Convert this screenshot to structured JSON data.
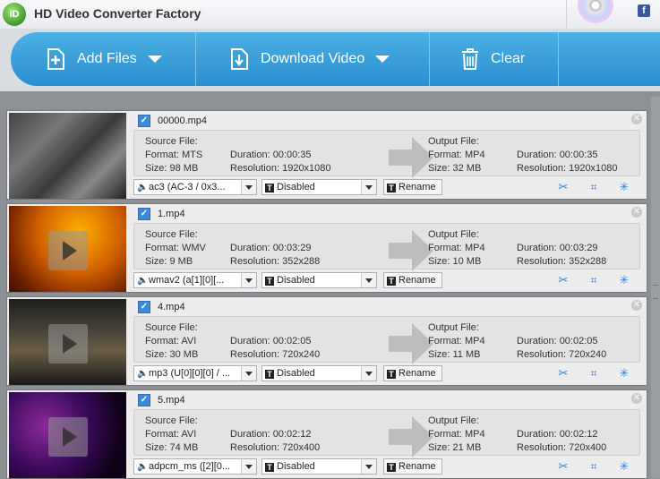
{
  "app": {
    "title": "HD Video Converter Factory",
    "logo_text": "iD",
    "social": "f"
  },
  "toolbar": {
    "add_files": "Add Files",
    "download_video": "Download Video",
    "clear": "Clear"
  },
  "labels": {
    "source_file": "Source File:",
    "output_file": "Output File:",
    "rename": "Rename"
  },
  "items": [
    {
      "filename": "00000.mp4",
      "src_format": "Format: MTS",
      "src_size": "Size: 98 MB",
      "src_duration": "Duration: 00:00:35",
      "src_resolution": "Resolution: 1920x1080",
      "out_format": "Format: MP4",
      "out_size": "Size: 32 MB",
      "out_duration": "Duration: 00:00:35",
      "out_resolution": "Resolution: 1920x1080",
      "audio": "ac3 (AC-3 / 0x3...",
      "subtitle": "Disabled"
    },
    {
      "filename": "1.mp4",
      "src_format": "Format: WMV",
      "src_size": "Size: 9 MB",
      "src_duration": "Duration: 00:03:29",
      "src_resolution": "Resolution: 352x288",
      "out_format": "Format: MP4",
      "out_size": "Size: 10 MB",
      "out_duration": "Duration: 00:03:29",
      "out_resolution": "Resolution: 352x288",
      "audio": "wmav2 (a[1][0][...",
      "subtitle": "Disabled"
    },
    {
      "filename": "4.mp4",
      "src_format": "Format: AVI",
      "src_size": "Size: 30 MB",
      "src_duration": "Duration: 00:02:05",
      "src_resolution": "Resolution: 720x240",
      "out_format": "Format: MP4",
      "out_size": "Size: 11 MB",
      "out_duration": "Duration: 00:02:05",
      "out_resolution": "Resolution: 720x240",
      "audio": "mp3 (U[0][0][0] / ...",
      "subtitle": "Disabled"
    },
    {
      "filename": "5.mp4",
      "src_format": "Format: AVI",
      "src_size": "Size: 74 MB",
      "src_duration": "Duration: 00:02:12",
      "src_resolution": "Resolution: 720x400",
      "out_format": "Format: MP4",
      "out_size": "Size: 21 MB",
      "out_duration": "Duration: 00:02:12",
      "out_resolution": "Resolution: 720x400",
      "audio": "adpcm_ms ([2][0...",
      "subtitle": "Disabled"
    }
  ],
  "colors": {
    "toolbar_blue": "#2a8fd0",
    "accent_icon": "#2a7ed3"
  },
  "icons": [
    "add-file-icon",
    "download-icon",
    "trash-icon",
    "speaker-icon",
    "subtitle-t-icon",
    "scissors-icon",
    "crop-icon",
    "effects-icon",
    "close-icon",
    "facebook-icon",
    "disc-icon"
  ]
}
